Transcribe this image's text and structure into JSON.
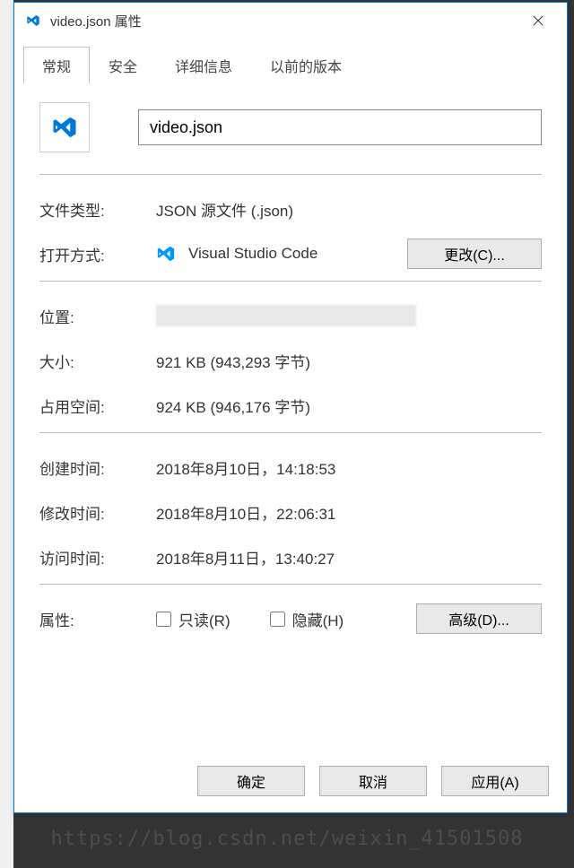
{
  "title": "video.json 属性",
  "tabs": {
    "general": "常规",
    "security": "安全",
    "details": "详细信息",
    "previous": "以前的版本"
  },
  "filename": "video.json",
  "labels": {
    "filetype": "文件类型:",
    "openwith": "打开方式:",
    "location": "位置:",
    "size": "大小:",
    "sizeondisk": "占用空间:",
    "created": "创建时间:",
    "modified": "修改时间:",
    "accessed": "访问时间:",
    "attributes": "属性:"
  },
  "values": {
    "filetype": "JSON 源文件 (.json)",
    "openwith": "Visual Studio Code",
    "size": "921 KB (943,293 字节)",
    "sizeondisk": "924 KB (946,176 字节)",
    "created": "2018年8月10日，14:18:53",
    "modified": "2018年8月10日，22:06:31",
    "accessed": "2018年8月11日，13:40:27"
  },
  "checkboxes": {
    "readonly": "只读(R)",
    "hidden": "隐藏(H)"
  },
  "buttons": {
    "change": "更改(C)...",
    "advanced": "高级(D)...",
    "ok": "确定",
    "cancel": "取消",
    "apply": "应用(A)"
  },
  "watermark": "https://blog.csdn.net/weixin_41501508"
}
